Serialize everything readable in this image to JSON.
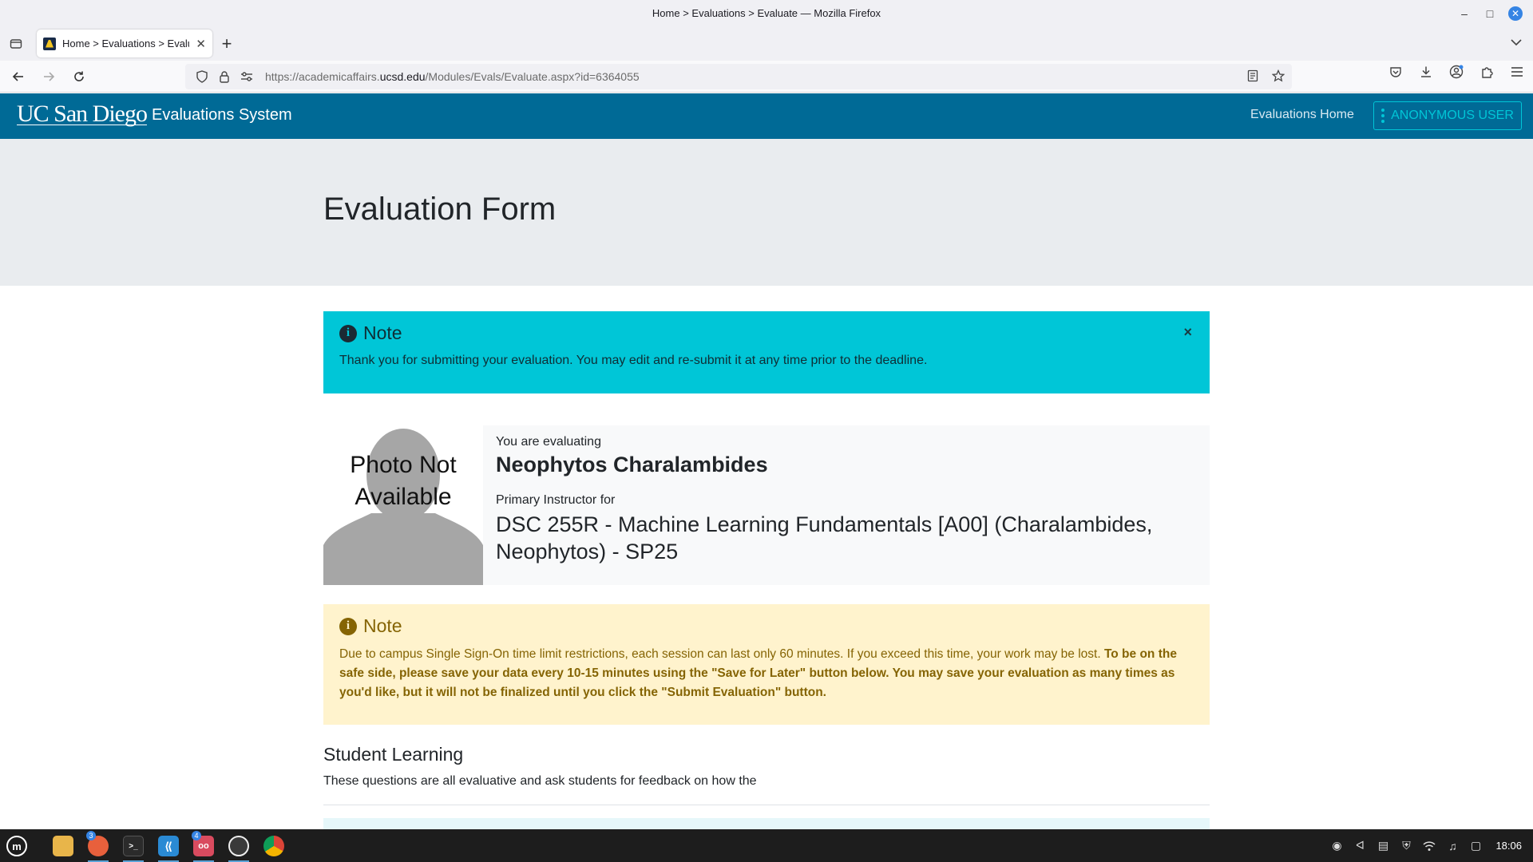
{
  "window": {
    "title": "Home > Evaluations > Evaluate — Mozilla Firefox"
  },
  "browser": {
    "tab_title": "Home > Evaluations > Evaluate",
    "url_prefix": "https://academicaffairs.",
    "url_domain": "ucsd.edu",
    "url_path": "/Modules/Evals/Evaluate.aspx?id=6364055"
  },
  "header": {
    "logo": "UC San Diego",
    "system_title": "Evaluations System",
    "home_link": "Evaluations Home",
    "user_button": "ANONYMOUS USER"
  },
  "hero": {
    "title": "Evaluation Form"
  },
  "info_alert": {
    "heading": "Note",
    "icon": "info-icon",
    "body": "Thank you for submitting your evaluation. You may edit and re-submit it at any time prior to the deadline.",
    "close": "×"
  },
  "evaluee": {
    "photo_text": "Photo Not Available",
    "you_are_evaluating": "You are evaluating",
    "instructor_name": "Neophytos Charalambides",
    "role_label": "Primary Instructor for",
    "course": "DSC 255R - Machine Learning Fundamentals [A00] (Charalambides, Neophytos) - SP25"
  },
  "warning_alert": {
    "heading": "Note",
    "icon": "info-icon",
    "body_plain": "Due to campus Single Sign-On time limit restrictions, each session can last only 60 minutes. If you exceed this time, your work may be lost. ",
    "body_bold": "To be on the safe side, please save your data every 10-15 minutes using the \"Save for Later\" button below. You may save your evaluation as many times as you'd like, but it will not be finalized until you click the \"Submit Evaluation\" button."
  },
  "section": {
    "title": "Student Learning",
    "description": "These questions are all evaluative and ask students for feedback on how the"
  },
  "taskbar": {
    "apps": [
      {
        "name": "menu-icon",
        "badge": ""
      },
      {
        "name": "files-icon",
        "badge": ""
      },
      {
        "name": "firefox-icon",
        "badge": "3"
      },
      {
        "name": "terminal-icon",
        "badge": ""
      },
      {
        "name": "vscode-icon",
        "badge": ""
      },
      {
        "name": "readers-icon",
        "badge": "4"
      },
      {
        "name": "obs-icon",
        "badge": ""
      },
      {
        "name": "chrome-icon",
        "badge": ""
      }
    ],
    "clock": "18:06"
  }
}
